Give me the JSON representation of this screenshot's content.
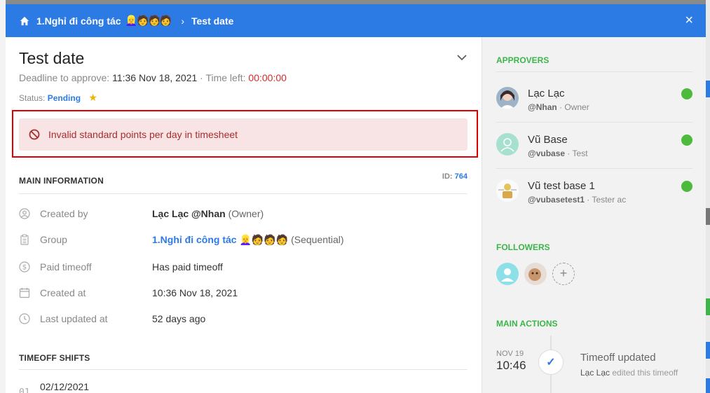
{
  "header": {
    "breadcrumb_group": "1.Nghỉ đi công tác",
    "breadcrumb_emojis": "👱‍♀️🧑🧑🧑",
    "breadcrumb_current": "Test date",
    "close_label": "×"
  },
  "request": {
    "title": "Test date",
    "deadline_label": "Deadline to approve:",
    "deadline_value": "11:36 Nov 18, 2021",
    "time_left_label": "· Time left:",
    "time_left_value": "00:00:00",
    "status_label": "Status:",
    "status_value": "Pending"
  },
  "error": {
    "message": "Invalid standard points per day in timesheet"
  },
  "main_info": {
    "heading": "MAIN INFORMATION",
    "id_label": "ID:",
    "id_value": "764",
    "created_by_label": "Created by",
    "created_by_name": "Lạc Lạc @Nhan",
    "created_by_role": "(Owner)",
    "group_label": "Group",
    "group_name": "1.Nghỉ đi công tác",
    "group_emojis": "👱‍♀️🧑🧑🧑",
    "group_mode": "(Sequential)",
    "paid_label": "Paid timeoff",
    "paid_value": "Has paid timeoff",
    "created_at_label": "Created at",
    "created_at_value": "10:36 Nov 18, 2021",
    "updated_label": "Last updated at",
    "updated_value": "52 days ago"
  },
  "timeoff_shifts": {
    "heading": "TIMEOFF SHIFTS",
    "rows": [
      {
        "num": "01",
        "date": "02/12/2021"
      }
    ]
  },
  "approvers": {
    "heading": "APPROVERS",
    "items": [
      {
        "name": "Lạc Lạc",
        "handle": "@Nhan",
        "role": "· Owner",
        "status_color": "#4cbb3c"
      },
      {
        "name": "Vũ Base",
        "handle": "@vubase",
        "role": "· Test",
        "status_color": "#4cbb3c"
      },
      {
        "name": "Vũ test base 1",
        "handle": "@vubasetest1",
        "role": "· Tester ac",
        "status_color": "#4cbb3c"
      }
    ]
  },
  "followers": {
    "heading": "FOLLOWERS",
    "add_label": "+"
  },
  "main_actions": {
    "heading": "MAIN ACTIONS",
    "items": [
      {
        "date": "NOV 19",
        "time": "10:46",
        "title": "Timeoff updated",
        "actor": "Lạc Lạc",
        "detail": "edited this timeoff"
      }
    ]
  },
  "colors": {
    "brand": "#2c7be5",
    "accent_green": "#3db54a",
    "error_text": "#a92d2d",
    "error_bg": "#f8e4e4",
    "deadline_red": "#d62b2b",
    "star": "#f0b400"
  }
}
